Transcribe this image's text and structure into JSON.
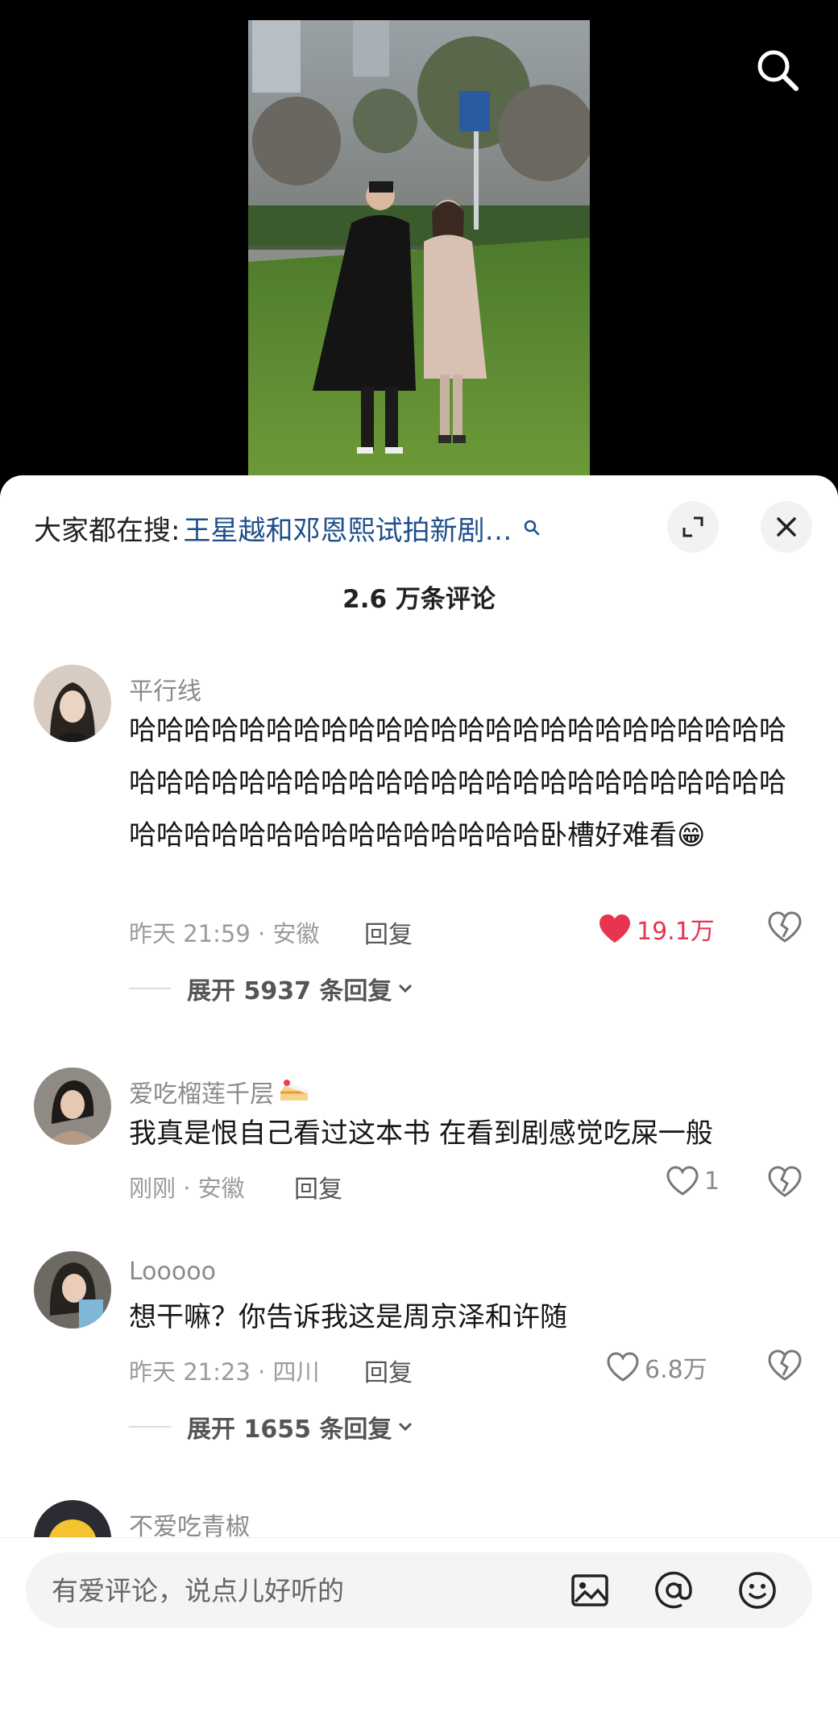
{
  "hot_search": {
    "prefix": "大家都在搜:",
    "term": "王星越和邓恩熙试拍新剧…"
  },
  "comment_count": "2.6 万条评论",
  "comments": [
    {
      "username": "平行线",
      "text": "哈哈哈哈哈哈哈哈哈哈哈哈哈哈哈哈哈哈哈哈哈哈哈哈哈哈哈哈哈哈哈哈哈哈哈哈哈哈哈哈哈哈哈哈哈哈哈哈哈哈哈哈哈哈哈哈哈哈哈哈哈哈哈卧槽好难看😁",
      "time_location": "昨天 21:59 · 安徽",
      "reply_label": "回复",
      "likes": "19.1万",
      "liked": true,
      "expand_label": "展开 5937 条回复"
    },
    {
      "username": "爱吃榴莲千层",
      "text": "我真是恨自己看过这本书 在看到剧感觉吃屎一般",
      "time_location": "刚刚 · 安徽",
      "reply_label": "回复",
      "likes": "1",
      "liked": false
    },
    {
      "username": "Looooo",
      "text": "想干嘛？你告诉我这是周京泽和许随",
      "time_location": "昨天 21:23 · 四川",
      "reply_label": "回复",
      "likes": "6.8万",
      "liked": false,
      "expand_label": "展开 1655 条回复"
    },
    {
      "username": "不爱吃青椒"
    }
  ],
  "input": {
    "placeholder": "有爱评论，说点儿好听的"
  },
  "icons": {
    "search": "search-icon",
    "expand": "expand-icon",
    "close": "close-icon",
    "like": "heart-icon",
    "dislike": "broken-heart-icon",
    "image": "image-icon",
    "mention": "at-icon",
    "emoji": "emoji-icon"
  },
  "colors": {
    "liked_red": "#e8344e",
    "hot_search_blue": "#1f4f8a"
  }
}
